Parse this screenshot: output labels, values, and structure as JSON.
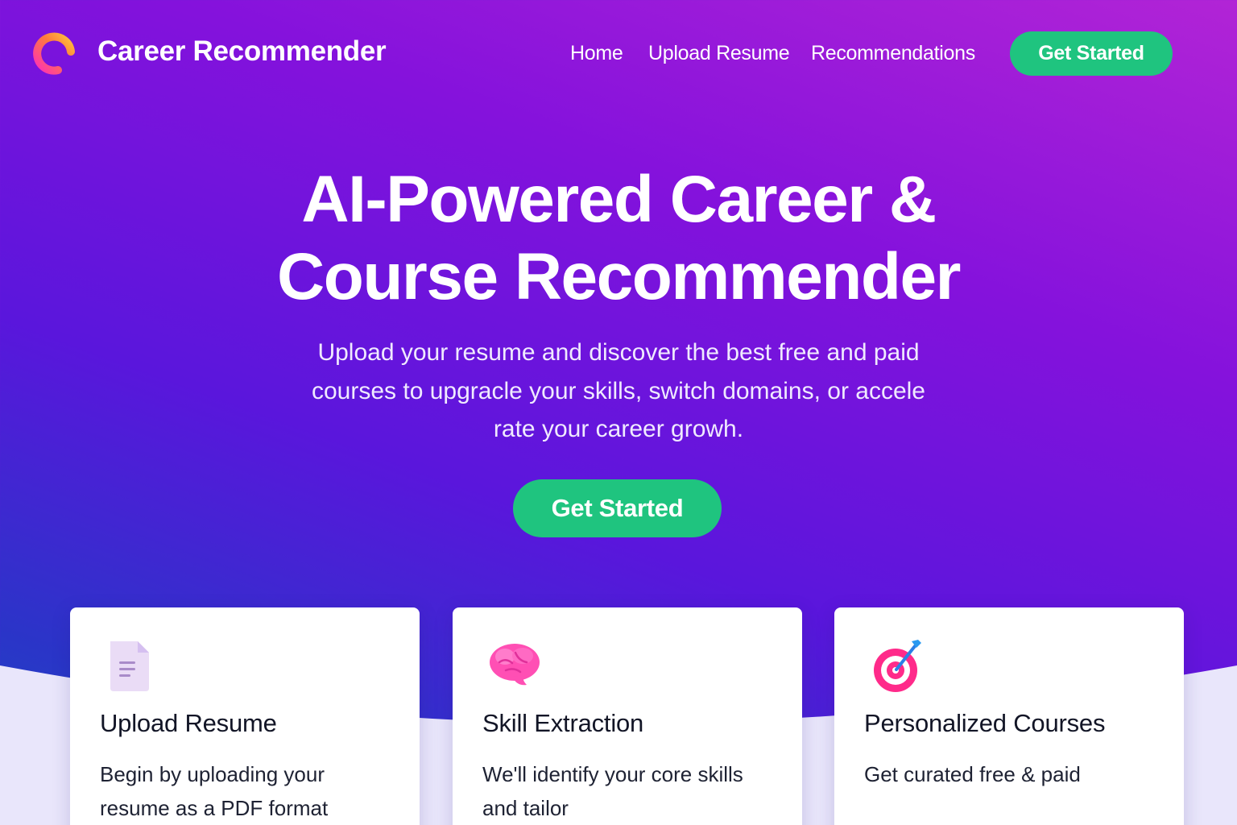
{
  "header": {
    "brand": "Career Recommender",
    "nav": [
      "Home",
      "Upload Resume",
      "Recommendations"
    ],
    "cta": "Get Started"
  },
  "hero": {
    "title_line1": "AI-Powered Career &",
    "title_line2": "Course Recommender",
    "subtitle_line1": "Upload your resume and discover the best free and paid",
    "subtitle_line2": "courses to upgracle your skills, switch domains, or accele",
    "subtitle_line3": "rate your career growh.",
    "cta": "Get Started"
  },
  "features": [
    {
      "icon": "document-icon",
      "title": "Upload Resume",
      "text": "Begin by uploading your resume as a PDF format"
    },
    {
      "icon": "brain-icon",
      "title": "Skill Extraction",
      "text": "We'll identify your core skills and tailor"
    },
    {
      "icon": "target-icon",
      "title": "Personalized Courses",
      "text": "Get curated free & paid"
    }
  ],
  "colors": {
    "accent_green": "#1fc47f",
    "gradient_top_right": "#b224d6",
    "gradient_bottom_left": "#1d4fc0",
    "wave": "#e9e6fb"
  }
}
